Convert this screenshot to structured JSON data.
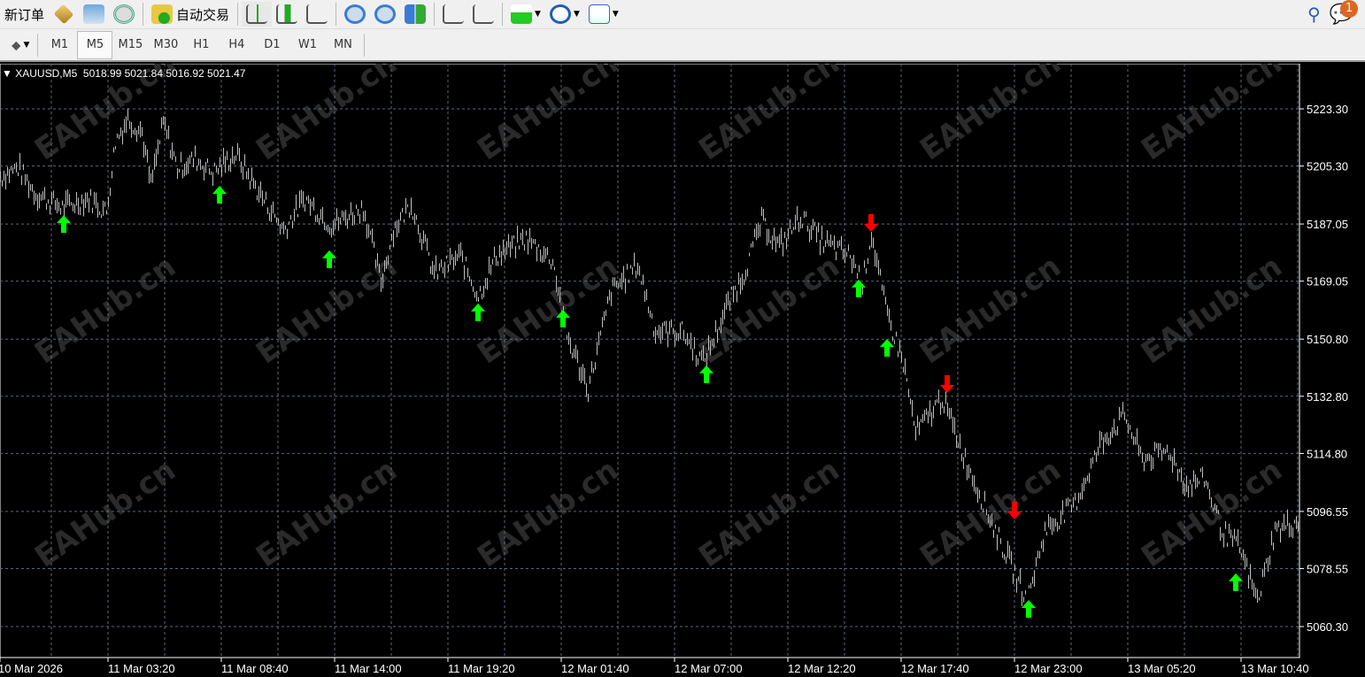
{
  "toolbar": {
    "new_order": "新订单",
    "auto_trading": "自动交易",
    "icons": [
      "metaquotes-diamond-icon",
      "market-watch-icon",
      "signals-icon",
      "auto-trading-icon",
      "bar-chart-icon",
      "candlestick-icon",
      "line-chart-icon",
      "zoom-in-icon",
      "zoom-out-icon",
      "tile-windows-icon",
      "chart-shift-icon",
      "autoscroll-icon",
      "indicators-icon",
      "periods-clock-icon",
      "templates-icon",
      "search-icon",
      "chat-icon"
    ],
    "notification_count": "1"
  },
  "timeframes": {
    "items": [
      "M1",
      "M5",
      "M15",
      "M30",
      "H1",
      "H4",
      "D1",
      "W1",
      "MN"
    ],
    "active": "M5"
  },
  "chart_header": {
    "symbol": "XAUUSD,M5",
    "ohlc": "5018.99 5021.84 5016.92 5021.47"
  },
  "watermark": "EAHub.cn",
  "colors": {
    "bars": "#c0c0c0",
    "grid": "#5a6a7a",
    "up_arrow": "#00ff00",
    "down_arrow": "#ff0000"
  },
  "chart_data": {
    "type": "line",
    "symbol": "XAUUSD",
    "timeframe": "M5",
    "y_ticks": [
      "5223.30",
      "5205.30",
      "5187.05",
      "5169.05",
      "5150.80",
      "5132.80",
      "5114.80",
      "5096.55",
      "5078.55",
      "5060.30"
    ],
    "ylim": [
      5055,
      5240
    ],
    "x_ticks": [
      "10 Mar 2026",
      "11 Mar 03:20",
      "11 Mar 08:40",
      "11 Mar 14:00",
      "11 Mar 19:20",
      "12 Mar 01:40",
      "12 Mar 07:00",
      "12 Mar 12:20",
      "12 Mar 17:40",
      "12 Mar 23:00",
      "13 Mar 05:20",
      "13 Mar 10:40"
    ],
    "grid": true,
    "price_path": [
      [
        "10 Mar 22:00",
        5201.8
      ],
      [
        "10 Mar 22:50",
        5204.6
      ],
      [
        "10 Mar 23:40",
        5196.3
      ],
      [
        "11 Mar 00:55",
        5192.1
      ],
      [
        "11 Mar 02:10",
        5194.9
      ],
      [
        "11 Mar 03:00",
        5190.7
      ],
      [
        "11 Mar 03:25",
        5213.0
      ],
      [
        "11 Mar 04:00",
        5220.0
      ],
      [
        "11 Mar 04:40",
        5215.8
      ],
      [
        "11 Mar 05:05",
        5199.1
      ],
      [
        "11 Mar 05:40",
        5218.6
      ],
      [
        "11 Mar 06:20",
        5204.6
      ],
      [
        "11 Mar 07:10",
        5207.4
      ],
      [
        "11 Mar 08:00",
        5203.2
      ],
      [
        "11 Mar 09:05",
        5208.8
      ],
      [
        "11 Mar 10:05",
        5197.7
      ],
      [
        "11 Mar 11:20",
        5185.1
      ],
      [
        "11 Mar 12:20",
        5194.9
      ],
      [
        "11 Mar 13:35",
        5186.5
      ],
      [
        "11 Mar 15:05",
        5192.1
      ],
      [
        "11 Mar 15:55",
        5168.4
      ],
      [
        "11 Mar 16:30",
        5185.1
      ],
      [
        "11 Mar 17:20",
        5193.5
      ],
      [
        "11 Mar 18:25",
        5171.2
      ],
      [
        "11 Mar 19:40",
        5176.8
      ],
      [
        "11 Mar 20:30",
        5164.2
      ],
      [
        "11 Mar 21:20",
        5176.8
      ],
      [
        "11 Mar 22:45",
        5182.3
      ],
      [
        "12 Mar 00:00",
        5175.4
      ],
      [
        "12 Mar 00:40",
        5151.7
      ],
      [
        "12 Mar 01:40",
        5135.0
      ],
      [
        "12 Mar 02:45",
        5165.6
      ],
      [
        "12 Mar 04:00",
        5174.0
      ],
      [
        "12 Mar 04:50",
        5153.1
      ],
      [
        "12 Mar 06:05",
        5153.1
      ],
      [
        "12 Mar 07:05",
        5143.3
      ],
      [
        "12 Mar 08:20",
        5162.8
      ],
      [
        "12 Mar 09:00",
        5171.2
      ],
      [
        "12 Mar 09:50",
        5187.9
      ],
      [
        "12 Mar 10:40",
        5179.6
      ],
      [
        "12 Mar 11:40",
        5189.3
      ],
      [
        "12 Mar 12:45",
        5181.0
      ],
      [
        "12 Mar 14:00",
        5176.8
      ],
      [
        "12 Mar 14:35",
        5168.4
      ],
      [
        "12 Mar 15:00",
        5183.7
      ],
      [
        "12 Mar 15:40",
        5160.1
      ],
      [
        "12 Mar 16:30",
        5143.3
      ],
      [
        "12 Mar 17:05",
        5121.1
      ],
      [
        "12 Mar 18:20",
        5132.2
      ],
      [
        "12 Mar 19:25",
        5112.7
      ],
      [
        "12 Mar 20:50",
        5090.4
      ],
      [
        "12 Mar 22:20",
        5068.1
      ],
      [
        "12 Mar 23:10",
        5090.4
      ],
      [
        "13 Mar 00:35",
        5098.8
      ],
      [
        "13 Mar 01:50",
        5118.3
      ],
      [
        "13 Mar 02:55",
        5126.6
      ],
      [
        "13 Mar 03:45",
        5112.7
      ],
      [
        "13 Mar 05:00",
        5115.5
      ],
      [
        "13 Mar 05:50",
        5104.3
      ],
      [
        "13 Mar 06:40",
        5107.1
      ],
      [
        "13 Mar 07:30",
        5090.4
      ],
      [
        "13 Mar 08:20",
        5084.8
      ],
      [
        "13 Mar 09:10",
        5068.1
      ],
      [
        "13 Mar 10:00",
        5090.4
      ],
      [
        "13 Mar 11:10",
        5093.2
      ]
    ],
    "buy_signals": [
      [
        "11 Mar 01:00",
        5186.5
      ],
      [
        "11 Mar 08:20",
        5195.7
      ],
      [
        "11 Mar 13:30",
        5175.4
      ],
      [
        "11 Mar 20:30",
        5158.7
      ],
      [
        "12 Mar 00:30",
        5156.7
      ],
      [
        "12 Mar 07:15",
        5139.2
      ],
      [
        "12 Mar 14:25",
        5166.2
      ],
      [
        "12 Mar 15:45",
        5147.5
      ],
      [
        "12 Mar 22:25",
        5065.3
      ],
      [
        "13 Mar 08:10",
        5073.7
      ]
    ],
    "sell_signals": [
      [
        "12 Mar 15:00",
        5187.9
      ],
      [
        "12 Mar 18:35",
        5137.2
      ],
      [
        "12 Mar 21:45",
        5097.4
      ]
    ]
  }
}
